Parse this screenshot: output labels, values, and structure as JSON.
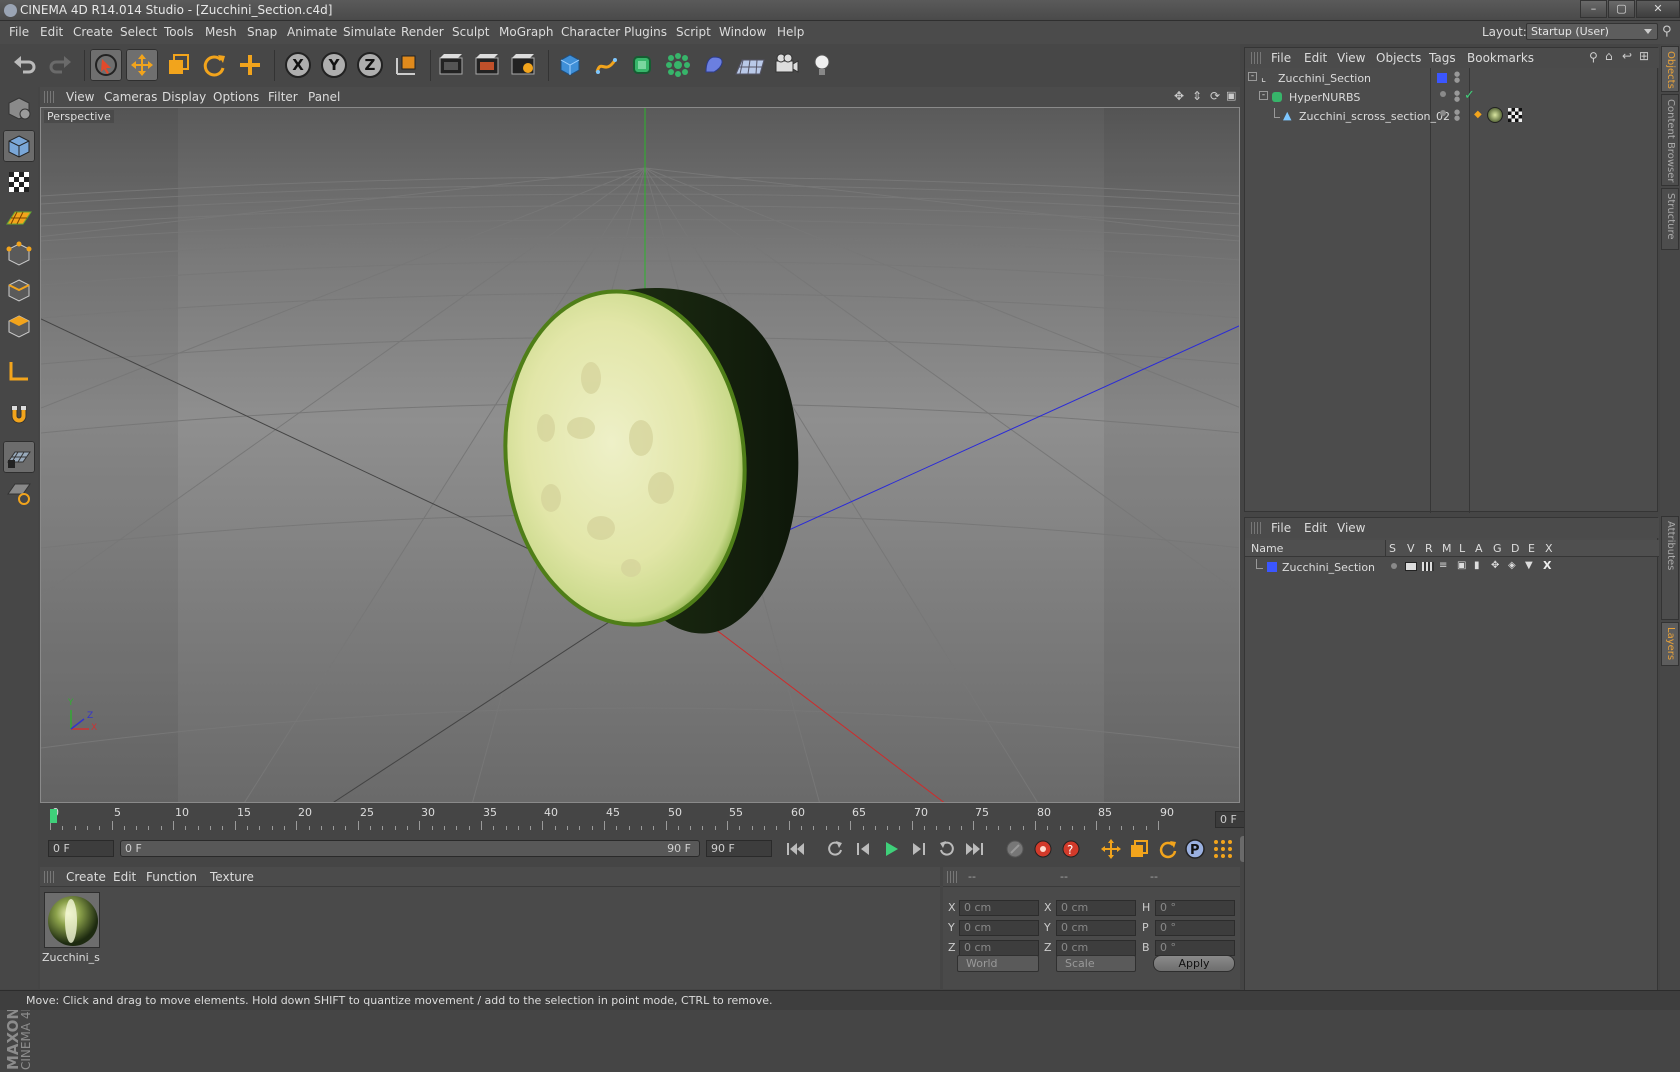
{
  "window": {
    "title": "CINEMA 4D R14.014 Studio - [Zucchini_Section.c4d]",
    "minimize": "–",
    "maximize": "▢",
    "close": "✕"
  },
  "menubar": {
    "items": [
      "File",
      "Edit",
      "Create",
      "Select",
      "Tools",
      "Mesh",
      "Snap",
      "Animate",
      "Simulate",
      "Render",
      "Sculpt",
      "MoGraph",
      "Character",
      "Plugins",
      "Script",
      "Window",
      "Help"
    ],
    "layout_label": "Layout:",
    "layout_value": "Startup (User)"
  },
  "toolbar": {
    "icons": [
      "undo-icon",
      "redo-icon",
      "live-selection-icon",
      "move-icon",
      "scale-icon",
      "rotate-icon",
      "add-icon",
      "x-axis-lock-icon",
      "y-axis-lock-icon",
      "z-axis-lock-icon",
      "coordinate-system-icon",
      "render-view-icon",
      "render-picture-viewer-icon",
      "render-settings-icon",
      "cube-icon",
      "spline-pen-icon",
      "nurbs-icon",
      "array-icon",
      "deformer-icon",
      "floor-icon",
      "camera-icon",
      "light-icon"
    ],
    "axis_labels": {
      "x": "X",
      "y": "Y",
      "z": "Z"
    }
  },
  "left_tools": [
    "make-editable-icon",
    "model-mode-icon",
    "texture-mode-icon",
    "workplane-icon",
    "points-mode-icon",
    "edges-mode-icon",
    "polygons-mode-icon",
    "axis-mode-icon",
    "magnet-icon",
    "snap-icon",
    "locked-workplane-icon"
  ],
  "viewport": {
    "menu": [
      "View",
      "Cameras",
      "Display",
      "Options",
      "Filter",
      "Panel"
    ],
    "label": "Perspective",
    "axis_y": "Y",
    "axis_x": "X",
    "axis_z": "Z"
  },
  "timeline": {
    "ticks": [
      "0",
      "5",
      "10",
      "15",
      "20",
      "25",
      "30",
      "35",
      "40",
      "45",
      "50",
      "55",
      "60",
      "65",
      "70",
      "75",
      "80",
      "85",
      "90"
    ],
    "current_frame": "0 F"
  },
  "transport": {
    "start_field": "0 F",
    "range_start": "0 F",
    "range_end": "90 F",
    "end_field": "90 F"
  },
  "material_manager": {
    "menu": [
      "Create",
      "Edit",
      "Function",
      "Texture"
    ],
    "material_name": "Zucchini_se"
  },
  "coordinates": {
    "header": [
      "--",
      "--",
      "--"
    ],
    "rows": [
      {
        "l1": "X",
        "v1": "0 cm",
        "l2": "X",
        "v2": "0 cm",
        "l3": "H",
        "v3": "0 °"
      },
      {
        "l1": "Y",
        "v1": "0 cm",
        "l2": "Y",
        "v2": "0 cm",
        "l3": "P",
        "v3": "0 °"
      },
      {
        "l1": "Z",
        "v1": "0 cm",
        "l2": "Z",
        "v2": "0 cm",
        "l3": "B",
        "v3": "0 °"
      }
    ],
    "mode1": "World",
    "mode2": "Scale",
    "apply": "Apply"
  },
  "object_manager": {
    "menu": [
      "File",
      "Edit",
      "View",
      "Objects",
      "Tags",
      "Bookmarks"
    ],
    "objects": [
      "Zucchini_Section",
      "HyperNURBS",
      "Zucchini_scross_section_02"
    ]
  },
  "layer_manager": {
    "menu": [
      "File",
      "Edit",
      "View"
    ],
    "columns": [
      "Name",
      "S",
      "V",
      "R",
      "M",
      "L",
      "A",
      "G",
      "D",
      "E",
      "X"
    ],
    "layers": [
      "Zucchini_Section"
    ]
  },
  "side_tabs": [
    "Objects",
    "Content Browser",
    "Structure",
    "Attributes",
    "Layers"
  ],
  "status": "Move: Click and drag to move elements. Hold down SHIFT to quantize movement / add to the selection in point mode, CTRL to remove.",
  "brand": {
    "line1": "MAXON",
    "line2": "CINEMA 4D"
  },
  "colors": {
    "accent": "#e8a23a",
    "layer_blue": "#3b56ff",
    "axis_x": "#d03030",
    "axis_y": "#28c028",
    "axis_z": "#3030d0"
  }
}
